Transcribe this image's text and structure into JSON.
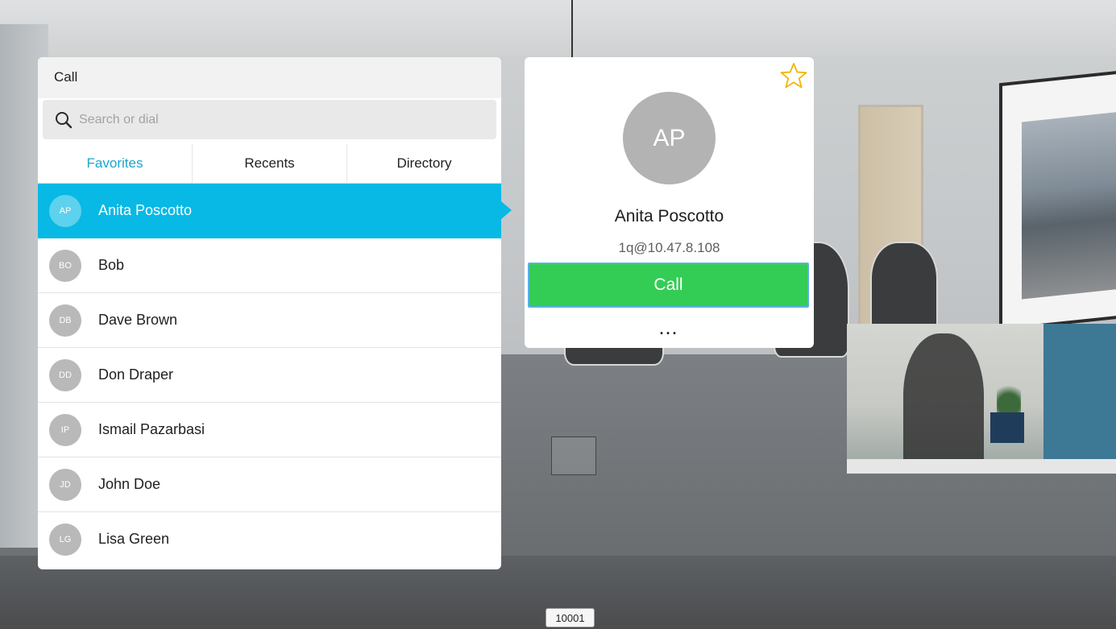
{
  "call_panel": {
    "title": "Call",
    "search_placeholder": "Search or dial",
    "tabs": [
      {
        "label": "Favorites",
        "active": true
      },
      {
        "label": "Recents",
        "active": false
      },
      {
        "label": "Directory",
        "active": false
      }
    ],
    "contacts": [
      {
        "initials": "AP",
        "name": "Anita Poscotto",
        "selected": true
      },
      {
        "initials": "BO",
        "name": "Bob",
        "selected": false
      },
      {
        "initials": "DB",
        "name": "Dave Brown",
        "selected": false
      },
      {
        "initials": "DD",
        "name": "Don Draper",
        "selected": false
      },
      {
        "initials": "IP",
        "name": "Ismail Pazarbasi",
        "selected": false
      },
      {
        "initials": "JD",
        "name": "John Doe",
        "selected": false
      },
      {
        "initials": "LG",
        "name": "Lisa Green",
        "selected": false
      }
    ]
  },
  "contact_card": {
    "initials": "AP",
    "name": "Anita Poscotto",
    "address": "1q@10.47.8.108",
    "call_label": "Call",
    "more_label": "...",
    "favorite_icon": "star-outline-icon"
  },
  "footer": {
    "number": "10001"
  },
  "colors": {
    "selected_row": "#07b9e4",
    "active_tab": "#1aa6cf",
    "call_button": "#33cc55",
    "star": "#f5b400"
  }
}
